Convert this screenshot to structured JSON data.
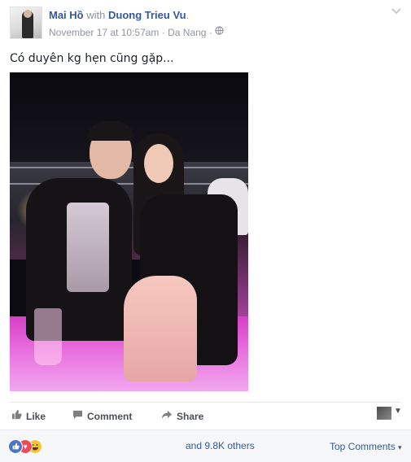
{
  "header": {
    "author": "Mai Hồ",
    "with_text": "with",
    "tagged": "Duong Trieu Vu",
    "tagged_suffix": ".",
    "timestamp": "November 17 at 10:57am",
    "separator": "·",
    "location": "Da Nang",
    "separator2": "·",
    "privacy_icon": "globe-icon",
    "menu_icon": "chevron-down-icon"
  },
  "post": {
    "text": "Có duyên kg hẹn cũng gặp..."
  },
  "actions": {
    "like_label": "Like",
    "comment_label": "Comment",
    "share_label": "Share"
  },
  "footer": {
    "reactions": [
      "like-icon",
      "love-icon",
      "haha-icon"
    ],
    "count_text": "and 9.8K others",
    "top_comments_label": "Top Comments",
    "top_comments_caret": "▾"
  },
  "colors": {
    "link": "#365899",
    "meta": "#90949c",
    "footer_bg": "#f6f7f9",
    "like_blue": "#4b76c2",
    "love_red": "#ed4a5a",
    "haha_yellow": "#f7c534"
  }
}
